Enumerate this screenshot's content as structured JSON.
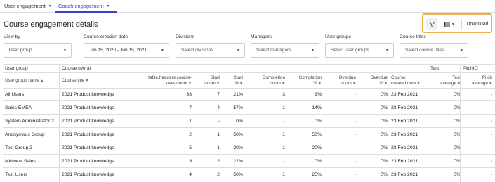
{
  "tabs": [
    {
      "label": "User engagement",
      "active": false
    },
    {
      "label": "Coach engagement",
      "active": true
    }
  ],
  "page_title": "Course engagement details",
  "toolbar": {
    "filter_icon": "filter-icon",
    "columns_icon": "columns-icon",
    "download_label": "Download"
  },
  "filters": [
    {
      "label": "View by",
      "value": "User group",
      "placeholder": false
    },
    {
      "label": "Course creation date",
      "value": "Jun 15, 2020 - Jun 15, 2021",
      "placeholder": false
    },
    {
      "label": "Divisions",
      "value": "Select divisions",
      "placeholder": true
    },
    {
      "label": "Managers",
      "value": "Select managers",
      "placeholder": true
    },
    {
      "label": "User groups",
      "value": "Select user groups",
      "placeholder": true
    },
    {
      "label": "Course titles",
      "value": "Select course titles",
      "placeholder": true
    }
  ],
  "table": {
    "groups": [
      "User group",
      "Course overall",
      "Test",
      "PitchIQ"
    ],
    "headers": [
      [
        "User group name"
      ],
      [
        "Course title"
      ],
      [
        "table.headers.course-",
        "user-count"
      ],
      [
        "Start",
        "count"
      ],
      [
        "Start",
        "%"
      ],
      [
        "Completion",
        "count"
      ],
      [
        "Completion",
        "%"
      ],
      [
        "Overdue",
        "count"
      ],
      [
        "Overdue",
        "%"
      ],
      [
        "Course",
        "created date"
      ],
      [
        "Test",
        "average"
      ],
      [
        "Pitch",
        "average"
      ]
    ],
    "rows": [
      [
        "All Users",
        "2021 Product knowledge",
        "33",
        "7",
        "21%",
        "3",
        "9%",
        "-",
        "0%",
        "23 Feb 2021",
        "0%",
        "-"
      ],
      [
        "Sales EMEA",
        "2021 Product knowledge",
        "7",
        "4",
        "57%",
        "1",
        "14%",
        "-",
        "0%",
        "23 Feb 2021",
        "0%",
        "-"
      ],
      [
        "System Administrator 2",
        "2021 Product knowledge",
        "1",
        "-",
        "0%",
        "-",
        "0%",
        "-",
        "0%",
        "23 Feb 2021",
        "0%",
        "-"
      ],
      [
        "Anonymous Group",
        "2021 Product knowledge",
        "2",
        "1",
        "50%",
        "1",
        "50%",
        "-",
        "0%",
        "23 Feb 2021",
        "0%",
        "-"
      ],
      [
        "Test Group 2",
        "2021 Product knowledge",
        "5",
        "1",
        "20%",
        "1",
        "20%",
        "-",
        "0%",
        "23 Feb 2021",
        "0%",
        "-"
      ],
      [
        "Midwest Sales",
        "2021 Product knowledge",
        "9",
        "2",
        "22%",
        "-",
        "0%",
        "-",
        "0%",
        "23 Feb 2021",
        "0%",
        "-"
      ],
      [
        "Test Users",
        "2021 Product knowledge",
        "4",
        "2",
        "50%",
        "1",
        "25%",
        "-",
        "0%",
        "23 Feb 2021",
        "0%",
        "-"
      ]
    ]
  },
  "colors": {
    "accent": "#3b3fd0",
    "highlight": "#f1b04d",
    "border": "#dcdde3"
  }
}
